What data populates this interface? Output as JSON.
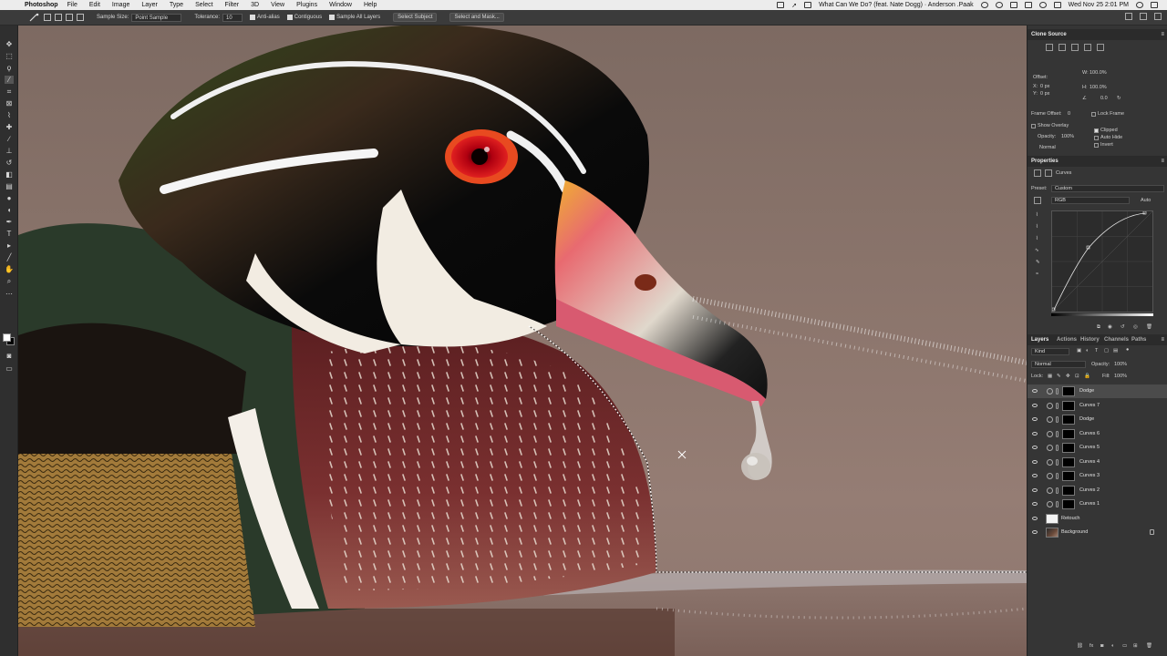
{
  "menubar": {
    "app_name": "Photoshop",
    "menus": [
      "File",
      "Edit",
      "Image",
      "Layer",
      "Type",
      "Select",
      "Filter",
      "3D",
      "View",
      "Plugins",
      "Window",
      "Help"
    ],
    "now_playing": "What Can We Do? (feat. Nate Dogg) · Anderson .Paak",
    "datetime": "Wed Nov 25  2:01 PM"
  },
  "options_bar": {
    "sample_size_label": "Sample Size:",
    "sample_size_value": "Point Sample",
    "tolerance_label": "Tolerance:",
    "tolerance_value": "10",
    "anti_alias_label": "Anti-alias",
    "contiguous_label": "Contiguous",
    "sample_all_layers_label": "Sample All Layers",
    "select_subject_label": "Select Subject",
    "select_and_mask_label": "Select and Mask..."
  },
  "clone_source": {
    "title": "Clone Source",
    "offset_label": "Offset:",
    "x_label": "X:",
    "x_value": "0 px",
    "y_label": "Y:",
    "y_value": "0 px",
    "w_label": "W:",
    "w_value": "100.0%",
    "h_label": "H:",
    "h_value": "100.0%",
    "angle_value": "0.0",
    "frame_offset_label": "Frame Offset:",
    "frame_offset_value": "0",
    "lock_frame_label": "Lock Frame",
    "show_overlay_label": "Show Overlay",
    "opacity_label": "Opacity:",
    "opacity_value": "100%",
    "blend_mode": "Normal",
    "clipped_label": "Clipped",
    "auto_hide_label": "Auto Hide",
    "invert_label": "Invert"
  },
  "properties": {
    "title": "Properties",
    "adjustment_name": "Curves",
    "preset_label": "Preset:",
    "preset_value": "Custom",
    "channel_value": "RGB",
    "auto_label": "Auto"
  },
  "layers_panel": {
    "tabs": [
      "Layers",
      "Actions",
      "History",
      "Channels",
      "Paths"
    ],
    "filter_kind": "Kind",
    "blend_mode": "Normal",
    "opacity_label": "Opacity:",
    "opacity_value": "100%",
    "lock_label": "Lock:",
    "fill_label": "Fill:",
    "fill_value": "100%",
    "layers": [
      {
        "name": "Dodge",
        "selected": true
      },
      {
        "name": "Curves 7",
        "selected": false
      },
      {
        "name": "Dodge",
        "selected": false
      },
      {
        "name": "Curves 6",
        "selected": false
      },
      {
        "name": "Curves 5",
        "selected": false
      },
      {
        "name": "Curves 4",
        "selected": false
      },
      {
        "name": "Curves 3",
        "selected": false
      },
      {
        "name": "Curves 2",
        "selected": false
      },
      {
        "name": "Curves 1",
        "selected": false
      },
      {
        "name": "Retouch",
        "selected": false
      },
      {
        "name": "Background",
        "selected": false
      }
    ]
  }
}
